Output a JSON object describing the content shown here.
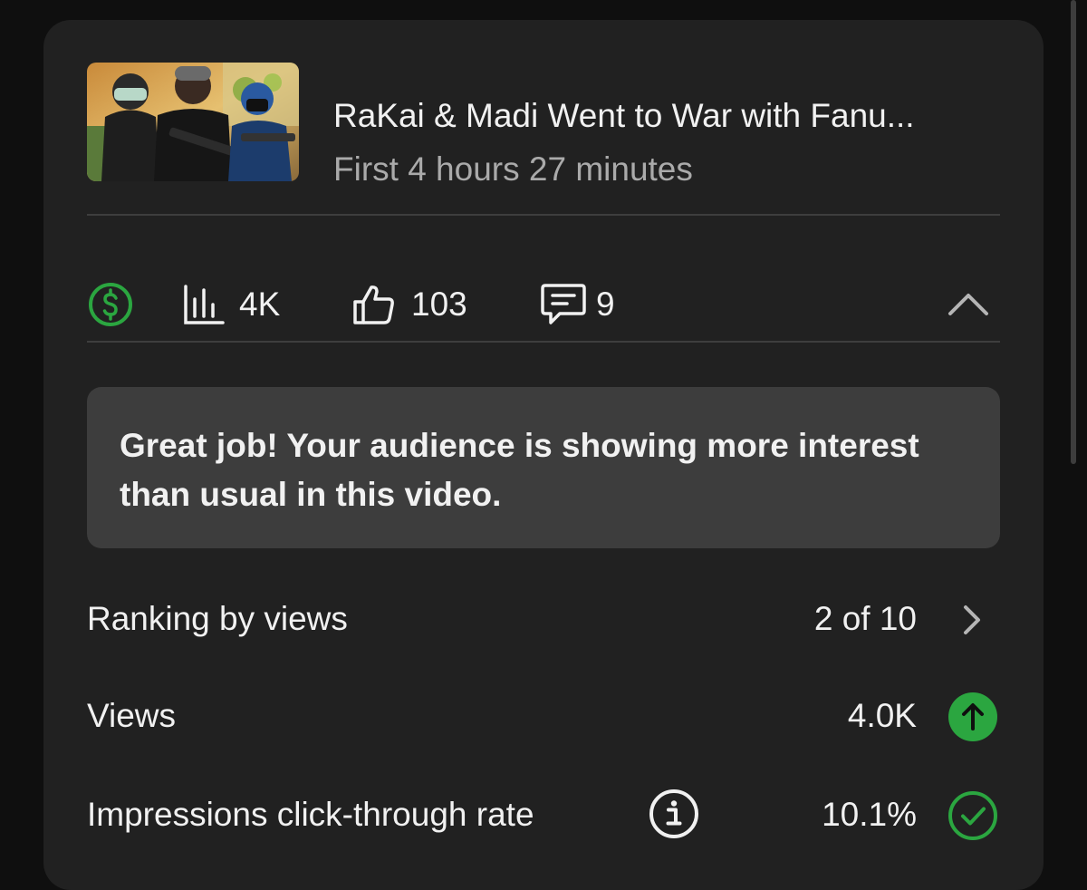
{
  "video": {
    "title": "RaKai & Madi Went to War with Fanu...",
    "subtitle": "First 4 hours 27 minutes"
  },
  "stats": {
    "monetization_icon": "dollar-icon",
    "views": "4K",
    "likes": "103",
    "comments": "9"
  },
  "banner": {
    "text": "Great job! Your audience is showing more interest than usual in this video."
  },
  "metrics": [
    {
      "label": "Ranking by views",
      "value": "2 of 10",
      "icon": "chevron-right-icon"
    },
    {
      "label": "Views",
      "value": "4.0K",
      "icon": "arrow-up-icon"
    },
    {
      "label": "Impressions click-through rate",
      "value": "10.1%",
      "icon": "check-circle-icon"
    }
  ],
  "colors": {
    "background": "#0f0f0f",
    "card": "#212121",
    "banner": "#3d3d3d",
    "accent_green": "#2ba640",
    "text_primary": "#f1f1f1",
    "text_secondary": "#aaaaaa"
  }
}
